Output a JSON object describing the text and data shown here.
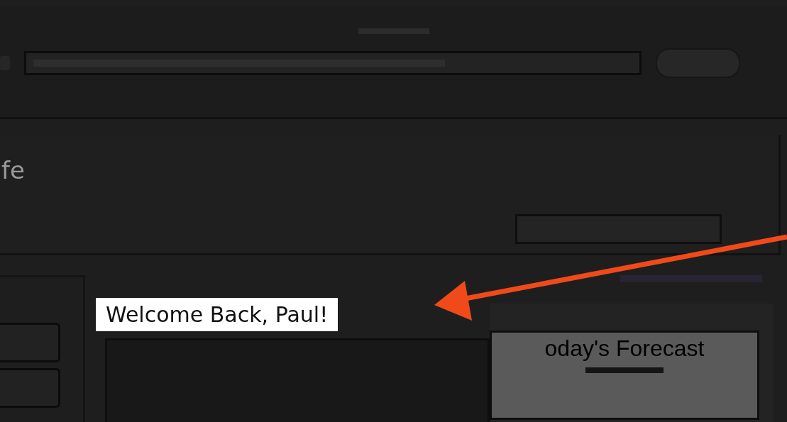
{
  "header": {
    "title": "fe"
  },
  "callout": {
    "text": "Welcome Back, Paul!"
  },
  "forecast": {
    "title": "oday's Forecast"
  }
}
